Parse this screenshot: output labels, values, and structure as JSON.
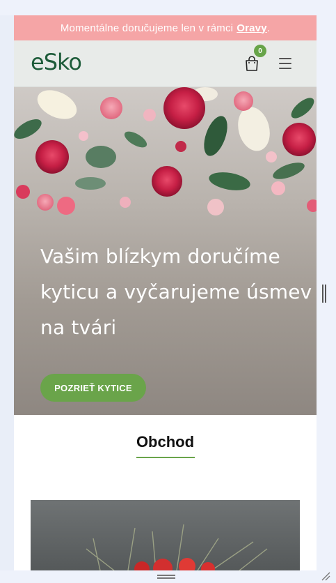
{
  "announcement": {
    "text": "Momentálne doručujeme len v rámci",
    "link": "Oravy",
    "suffix": "."
  },
  "header": {
    "logo": "eSko",
    "cart_count": "0",
    "icons": [
      "cart-icon",
      "hamburger-menu-icon"
    ]
  },
  "hero": {
    "title": "Vašim blízkym doručíme kyticu a vyčarujeme úsmev na tvári",
    "button_label": "POZRIEŤ KYTICE"
  },
  "shop": {
    "title": "Obchod"
  },
  "colors": {
    "announcement_bg": "#f5a5a6",
    "accent_green": "#6aa44a",
    "logo_green": "#1e5c3a",
    "header_bg": "#e8ebe9"
  }
}
